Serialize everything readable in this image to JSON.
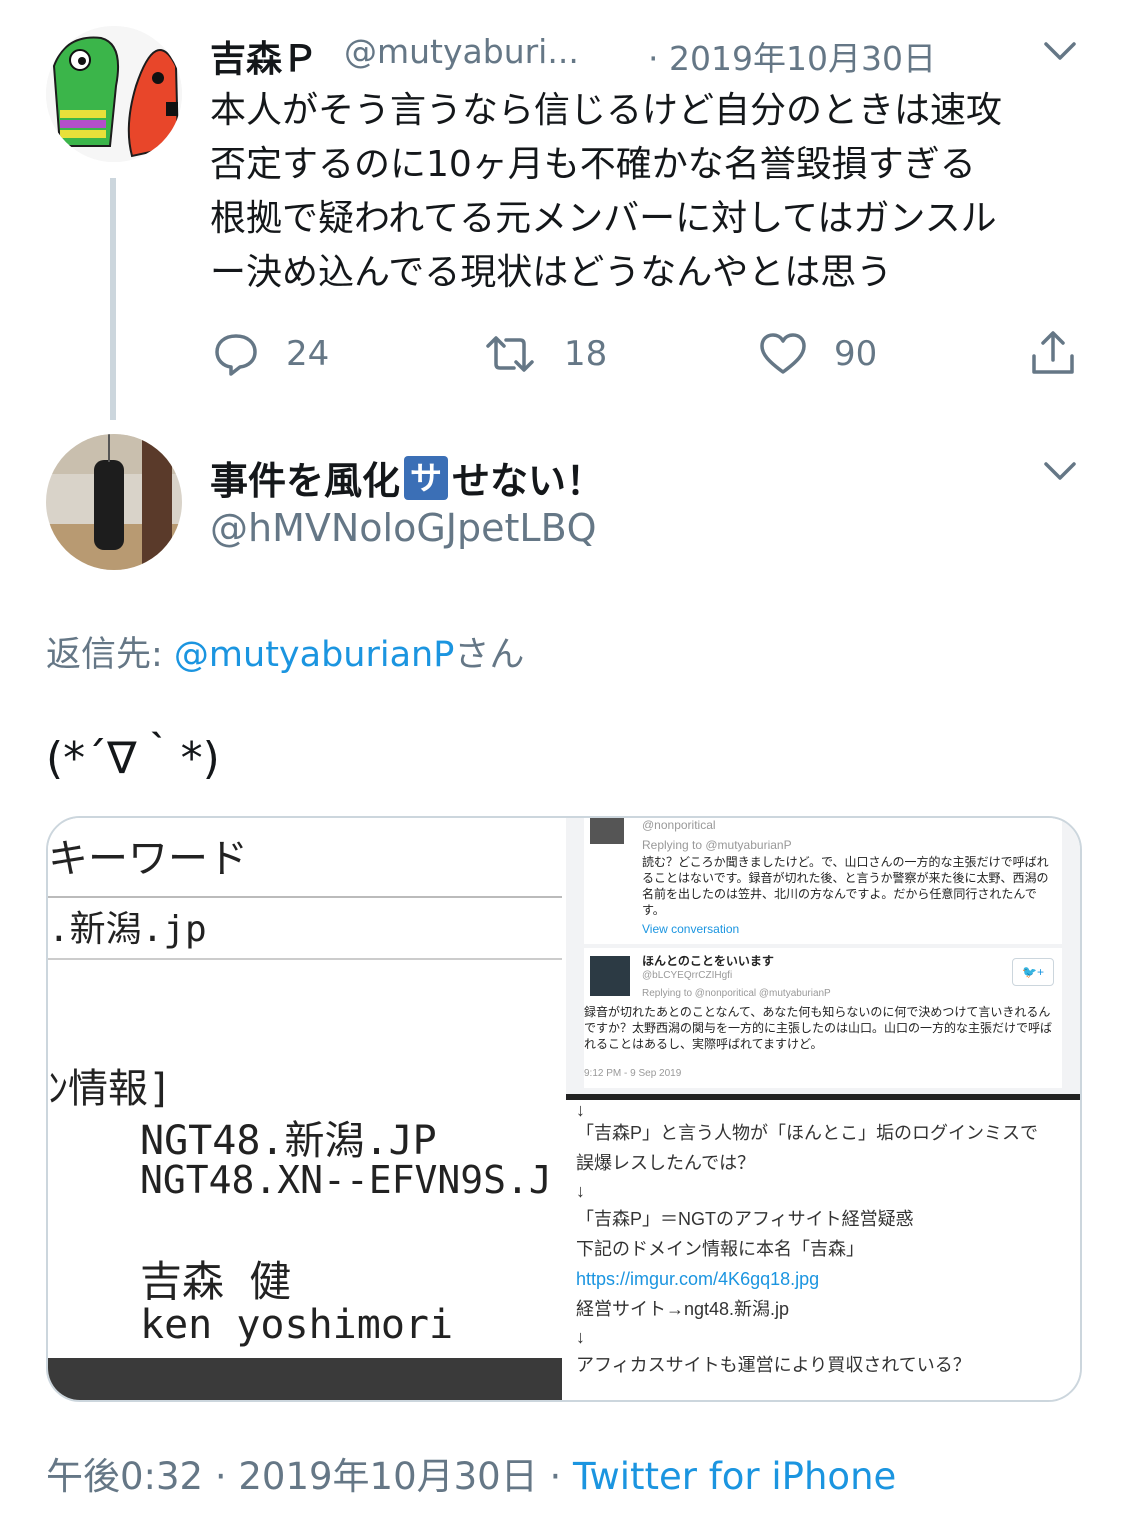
{
  "parent_tweet": {
    "display_name": "吉森Ｐ",
    "handle": "@mutyaburi...",
    "date": "· 2019年10月30日",
    "text_lines": [
      "本人がそう言うなら信じるけど自分のときは速攻",
      "否定するのに10ヶ月も不確かな名誉毀損すぎる",
      "根拠で疑われてる元メンバーに対してはガンスル",
      "ー決め込んでる現状はどうなんやとは思う"
    ],
    "actions": {
      "replies": "24",
      "retweets": "18",
      "likes": "90"
    }
  },
  "main_tweet": {
    "display_name_pre": "事件を風化",
    "display_name_badge": "サ",
    "display_name_post": "せない！",
    "handle": "@hMVNoloGJpetLBQ",
    "reply_to_label": "返信先: ",
    "reply_to_user": "@mutyaburianP",
    "reply_to_suffix": "さん",
    "text": "(*´∇｀*)",
    "meta_time": "午後0:32 · 2019年10月30日 · ",
    "meta_source": "Twitter for iPhone"
  },
  "media": {
    "left_panel": {
      "line1": "キーワード",
      "line2": ".新潟.jp",
      "line3": "ﾝ情報]",
      "line4": "NGT48.新潟.JP",
      "line5": "NGT48.XN--EFVN9S.J",
      "line6": "吉森 健",
      "line7": "ken yoshimori"
    },
    "top_right": {
      "handle1": "@nonporitical",
      "replying1": "Replying to @mutyaburianP",
      "text1": "読む？どころか聞きましたけど。で、山口さんの一方的な主張だけで呼ばれることはないです。録音が切れた後、と言うか警察が来た後に太野、西潟の名前を出したのは笠井、北川の方なんですよ。だから任意同行されたんです。",
      "view": "View conversation",
      "name2": "ほんとのことをいいます",
      "handle2": "@bLCYEQrrCZIHgfi",
      "replying2": "Replying to @nonporitical @mutyaburianP",
      "text2": "録音が切れたあとのことなんて、あなた何も知らないのに何で決めつけて言いきれるんですか？太野西潟の関与を一方的に主張したのは山口。山口の一方的な主張だけで呼ばれることはあるし、実際呼ばれてますけど。",
      "time2": "9:12 PM - 9 Sep 2019"
    },
    "bottom_right": {
      "l1": "↓",
      "l2": "「吉森P」と言う人物が「ほんとこ」垢のログインミスで",
      "l3": "誤爆レスしたんでは？",
      "l4": "↓",
      "l5": "「吉森P」＝NGTのアフィサイト経営疑惑",
      "l6": "下記のドメイン情報に本名「吉森」",
      "l7": "https://imgur.com/4K6gq18.jpg",
      "l8": "経営サイト→ngt48.新潟.jp",
      "l9": "↓",
      "l10": "アフィカスサイトも運営により買収されている？"
    }
  },
  "colors": {
    "link": "#1b95e0",
    "secondary": "#657786",
    "badge": "#3b6fb6"
  },
  "icons": [
    "reply-icon",
    "retweet-icon",
    "like-icon",
    "share-icon",
    "chevron-down-icon"
  ]
}
